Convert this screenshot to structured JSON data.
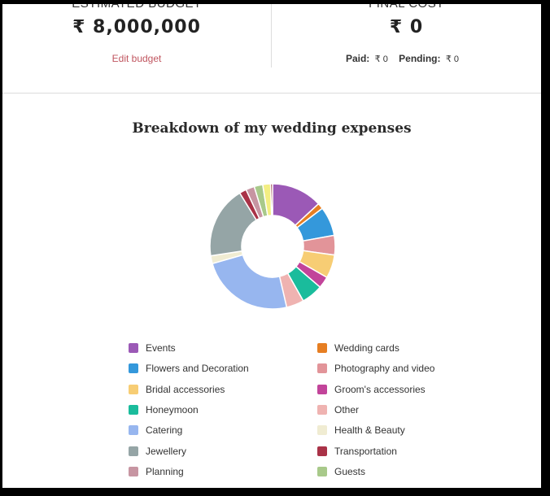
{
  "summary": {
    "estimated_budget": {
      "label": "Estimated Budget",
      "value": "₹ 8,000,000",
      "edit_link": "Edit budget"
    },
    "final_cost": {
      "label": "Final Cost",
      "value": "₹ 0",
      "paid_label": "Paid:",
      "paid_value": "₹ 0",
      "pending_label": "Pending:",
      "pending_value": "₹ 0"
    }
  },
  "chart_data": {
    "type": "pie",
    "variant": "donut",
    "title": "Breakdown of my wedding expenses",
    "unit": "percent (estimated from slice angles)",
    "legend_position": "bottom",
    "slices": [
      {
        "name": "Events",
        "value": 13.0,
        "color": "#9b59b6"
      },
      {
        "name": "Wedding cards",
        "value": 1.5,
        "color": "#e67e22"
      },
      {
        "name": "Flowers and Decoration",
        "value": 7.5,
        "color": "#3498db"
      },
      {
        "name": "Photography and video",
        "value": 5.0,
        "color": "#e29499"
      },
      {
        "name": "Bridal accessories",
        "value": 6.0,
        "color": "#f7cd74"
      },
      {
        "name": "Groom's accessories",
        "value": 3.0,
        "color": "#c2449a"
      },
      {
        "name": "Honeymoon",
        "value": 5.5,
        "color": "#1abc9c"
      },
      {
        "name": "Other",
        "value": 4.5,
        "color": "#efb3b1"
      },
      {
        "name": "Catering",
        "value": 24.0,
        "color": "#97b6ef"
      },
      {
        "name": "Health & Beauty",
        "value": 2.0,
        "color": "#f0ecd2"
      },
      {
        "name": "Jewellery",
        "value": 18.5,
        "color": "#95a5a6"
      },
      {
        "name": "Transportation",
        "value": 1.8,
        "color": "#a93247"
      },
      {
        "name": "Planning",
        "value": 2.2,
        "color": "#c795a2"
      },
      {
        "name": "Guests",
        "value": 2.2,
        "color": "#a8c98a"
      },
      {
        "name": "(unlabeled)",
        "value": 2.0,
        "color": "#f3ee82"
      },
      {
        "name": "(unlabeled)",
        "value": 0.5,
        "color": "#8e2a36"
      }
    ]
  },
  "legend": {
    "left": [
      {
        "label": "Events",
        "color": "#9b59b6"
      },
      {
        "label": "Flowers and Decoration",
        "color": "#3498db"
      },
      {
        "label": "Bridal accessories",
        "color": "#f7cd74"
      },
      {
        "label": "Honeymoon",
        "color": "#1abc9c"
      },
      {
        "label": "Catering",
        "color": "#97b6ef"
      },
      {
        "label": "Jewellery",
        "color": "#95a5a6"
      },
      {
        "label": "Planning",
        "color": "#c795a2"
      }
    ],
    "right": [
      {
        "label": "Wedding cards",
        "color": "#e67e22"
      },
      {
        "label": "Photography and video",
        "color": "#e29499"
      },
      {
        "label": "Groom's accessories",
        "color": "#c2449a"
      },
      {
        "label": "Other",
        "color": "#efb3b1"
      },
      {
        "label": "Health & Beauty",
        "color": "#f0ecd2"
      },
      {
        "label": "Transportation",
        "color": "#a93247"
      },
      {
        "label": "Guests",
        "color": "#a8c98a"
      }
    ]
  }
}
